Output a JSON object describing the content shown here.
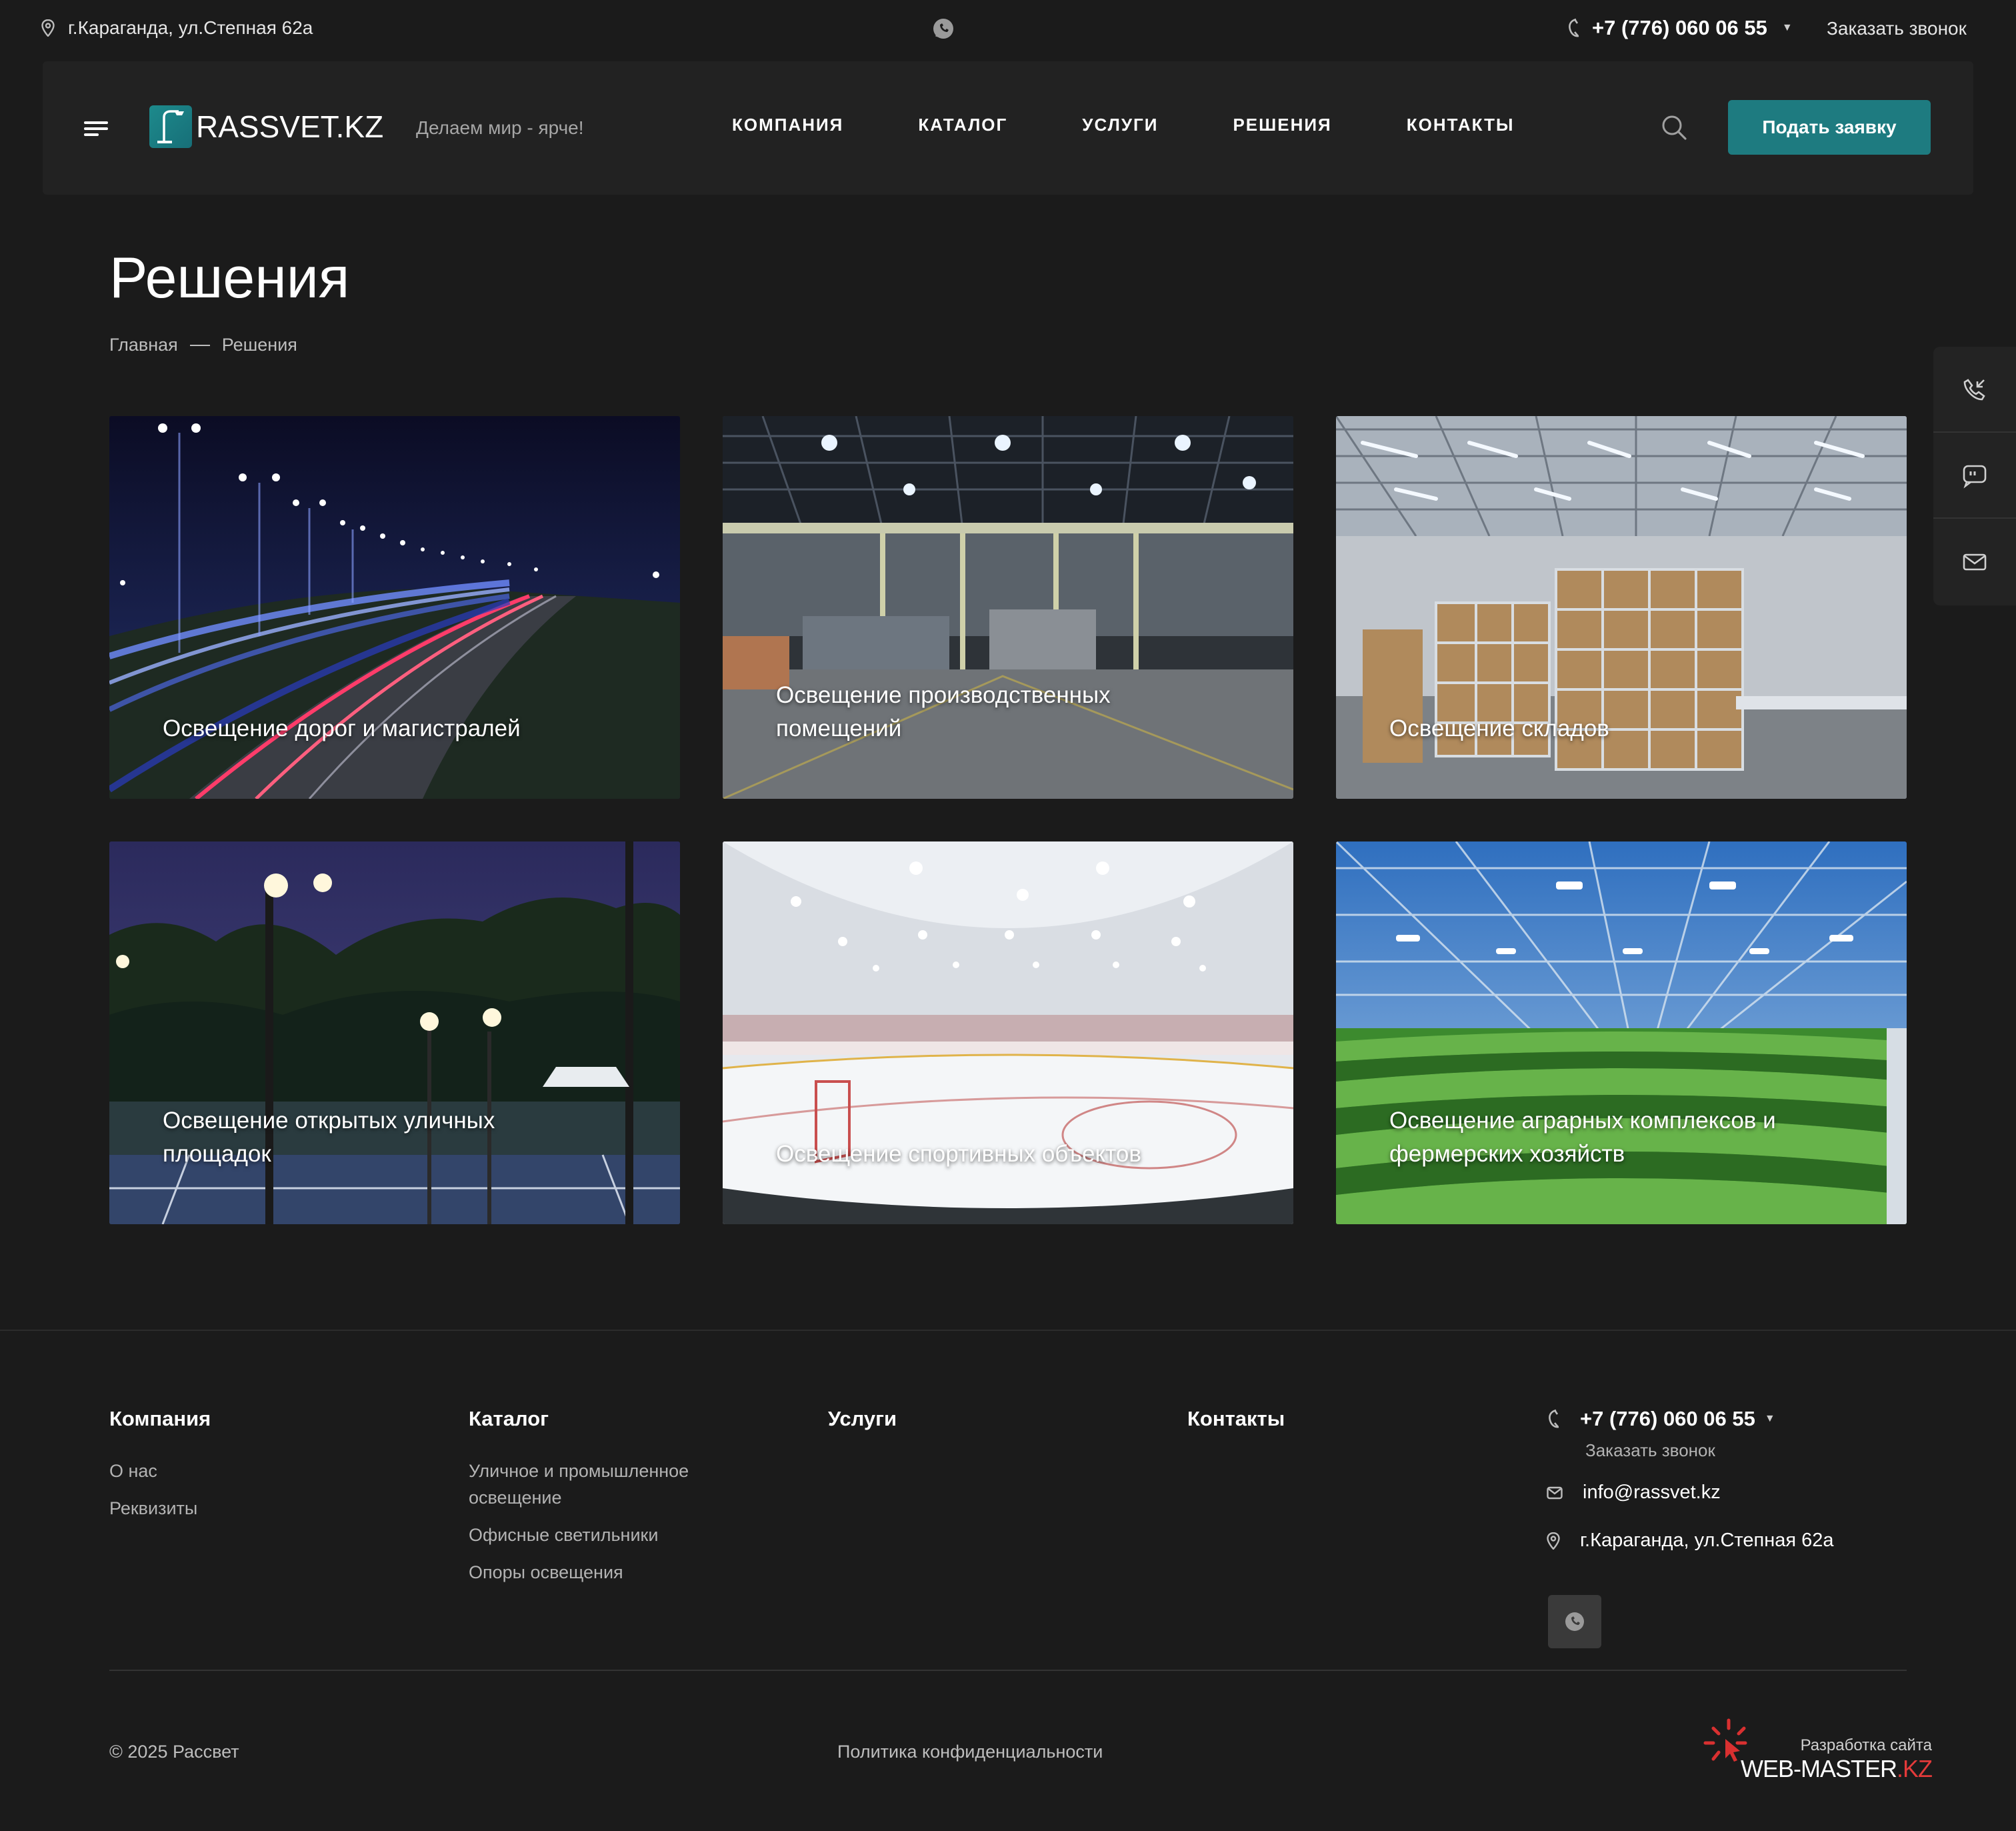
{
  "topbar": {
    "address": "г.Караганда, ул.Степная 62а",
    "phone": "+7 (776) 060 06 55",
    "callback": "Заказать звонок"
  },
  "header": {
    "logo_text": "RASSVET.KZ",
    "slogan": "Делаем мир - ярче!",
    "nav": [
      {
        "label": "КОМПАНИЯ"
      },
      {
        "label": "КАТАЛОГ"
      },
      {
        "label": "УСЛУГИ"
      },
      {
        "label": "РЕШЕНИЯ"
      },
      {
        "label": "КОНТАКТЫ"
      }
    ],
    "cta": "Подать заявку"
  },
  "page": {
    "title": "Решения",
    "breadcrumb": [
      "Главная",
      "Решения"
    ]
  },
  "solutions": [
    {
      "label": "Освещение дорог и магистралей",
      "icon": "road-lighting-photo"
    },
    {
      "label": "Освещение производственных помещений",
      "icon": "factory-lighting-photo"
    },
    {
      "label": "Освещение складов",
      "icon": "warehouse-lighting-photo"
    },
    {
      "label": "Освещение открытых уличных площадок",
      "icon": "outdoor-court-lighting-photo"
    },
    {
      "label": "Освещение спортивных объектов",
      "icon": "ice-rink-lighting-photo"
    },
    {
      "label": "Освещение аграрных комплексов и фермерских хозяйств",
      "icon": "greenhouse-lighting-photo"
    }
  ],
  "side_widget": [
    "phone-callback-icon",
    "chat-icon",
    "mail-icon"
  ],
  "footer": {
    "columns": [
      {
        "title": "Компания",
        "links": [
          "О нас",
          "Реквизиты"
        ]
      },
      {
        "title": "Каталог",
        "links": [
          "Уличное и промышленное освещение",
          "Офисные светильники",
          "Опоры освещения"
        ]
      },
      {
        "title": "Услуги",
        "links": []
      },
      {
        "title": "Контакты",
        "links": []
      }
    ],
    "phone": "+7 (776) 060 06 55",
    "callback": "Заказать звонок",
    "email": "info@rassvet.kz",
    "address": "г.Караганда, ул.Степная 62а",
    "copyright": "© 2025 Рассвет",
    "privacy": "Политика конфиденциальности",
    "developer_caption": "Разработка сайта",
    "developer_name": "WEB-MASTER",
    "developer_tld": ".KZ"
  },
  "colors": {
    "background": "#1b1b1b",
    "header": "#222222",
    "accent": "#1e7b80"
  }
}
